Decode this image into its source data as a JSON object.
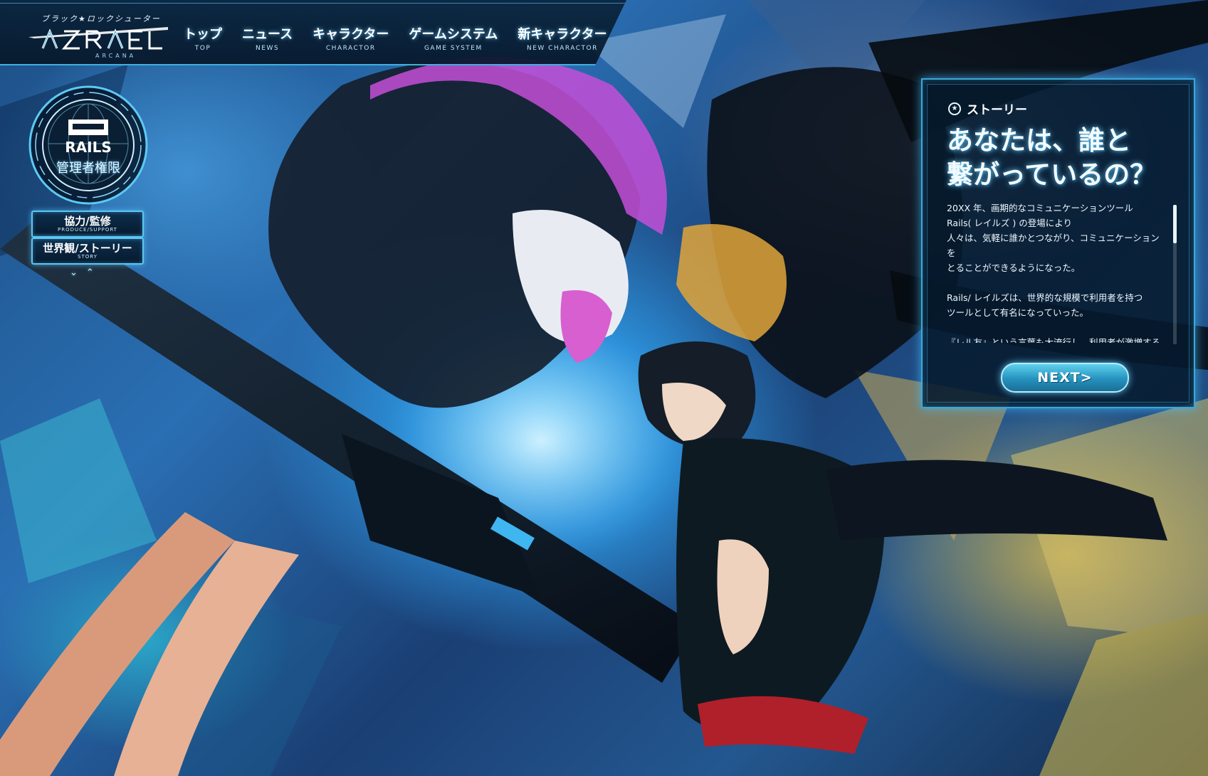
{
  "logo": {
    "kana": "ブラック★ロックシューター",
    "title": "AZRAEL",
    "sub": "ARCANA"
  },
  "nav": {
    "items": [
      {
        "jp": "トップ",
        "en": "TOP"
      },
      {
        "jp": "ニュース",
        "en": "NEWS"
      },
      {
        "jp": "キャラクター",
        "en": "CHARACTOR"
      },
      {
        "jp": "ゲームシステム",
        "en": "GAME SYSTEM"
      },
      {
        "jp": "新キャラクター",
        "en": "NEW CHARACTOR"
      }
    ]
  },
  "emblem": {
    "mark": "RAILS",
    "label": "管理者権限"
  },
  "side_buttons": [
    {
      "jp": "協力/監修",
      "en": "PRODUCE/SUPPORT"
    },
    {
      "jp": "世界観/ストーリー",
      "en": "STORY"
    }
  ],
  "scroll_arrows": {
    "down": "⌄",
    "up": "⌃"
  },
  "story": {
    "header_icon": "★",
    "header": "ストーリー",
    "title": "あなたは、誰と\n繋がっているの？",
    "paragraphs": [
      "20XX 年、画期的なコミュニケーションツール\nRails( レイルズ ) の登場により\n人々は、気軽に誰かとつながり、コミュニケーションを\nとることができるようになった。",
      "Rails/ レイルズは、世界的な規模で利用者を持つ\nツールとして有名になっていった。",
      "『レル友』という言葉も大流行し、利用者が激増する中\nRails 使用中にフラットライン症状を"
    ],
    "scroll_position": 0.0,
    "next_label": "NEXT>"
  },
  "colors": {
    "accent": "#3aa8dc",
    "panel": "#061a2e",
    "next_button": "#2591bd"
  }
}
